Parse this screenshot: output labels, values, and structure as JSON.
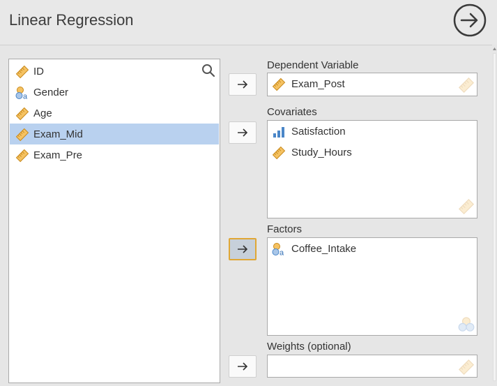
{
  "header": {
    "title": "Linear Regression"
  },
  "variables": [
    {
      "label": "ID",
      "icon": "ruler-icon",
      "selected": false
    },
    {
      "label": "Gender",
      "icon": "nominal-text-icon",
      "selected": false
    },
    {
      "label": "Age",
      "icon": "ruler-icon",
      "selected": false
    },
    {
      "label": "Exam_Mid",
      "icon": "ruler-icon",
      "selected": true
    },
    {
      "label": "Exam_Pre",
      "icon": "ruler-icon",
      "selected": false
    }
  ],
  "dependent": {
    "label": "Dependent Variable",
    "items": [
      "Exam_Post"
    ]
  },
  "covariates": {
    "label": "Covariates",
    "items": [
      "Satisfaction",
      "Study_Hours"
    ]
  },
  "factors": {
    "label": "Factors",
    "items": [
      "Coffee_Intake"
    ]
  },
  "weights": {
    "label": "Weights (optional)",
    "items": []
  },
  "colors": {
    "selection": "#b9d1ef",
    "accent_border": "#e0a735",
    "ruler": "#f0b043",
    "nominal_blue": "#4a86c8"
  }
}
